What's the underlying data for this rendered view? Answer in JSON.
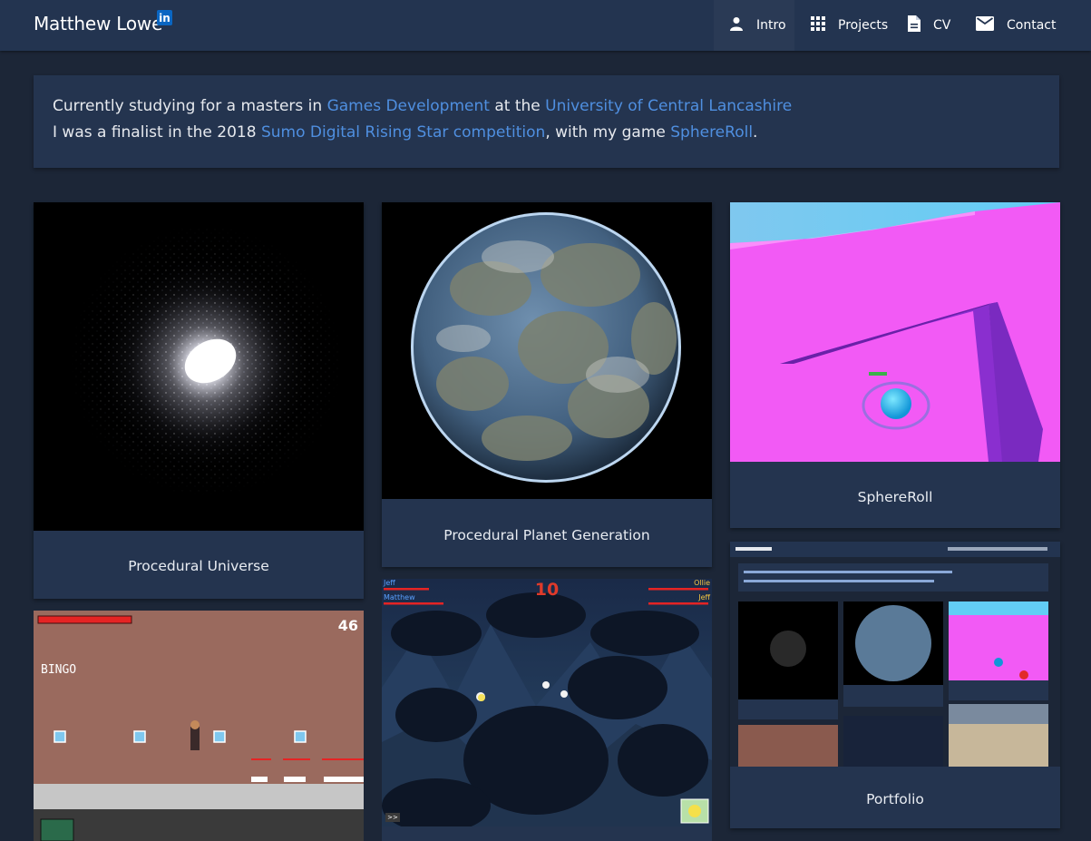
{
  "nav": {
    "brand": "Matthew Lowe",
    "linkedin_badge": "in",
    "items": [
      {
        "label": "Intro",
        "icon": "person-icon",
        "active": true
      },
      {
        "label": "Projects",
        "icon": "grid-icon",
        "active": false
      },
      {
        "label": "CV",
        "icon": "document-icon",
        "active": false
      },
      {
        "label": "Contact",
        "icon": "mail-icon",
        "active": false
      }
    ]
  },
  "intro": {
    "line1_prefix": "Currently studying for a masters in ",
    "line1_link1": "Games Development",
    "line1_mid": " at the ",
    "line1_link2": "University of Central Lancashire",
    "line2_prefix": "I was a finalist in the 2018 ",
    "line2_link1": "Sumo Digital Rising Star competition",
    "line2_mid": ", with my game ",
    "line2_link2": "SphereRoll",
    "line2_suffix": "."
  },
  "projects": [
    {
      "title": "Procedural Universe"
    },
    {
      "title": "Procedural Planet Generation"
    },
    {
      "title": "SphereRoll"
    },
    {
      "title": "Portfolio"
    }
  ],
  "bingo_game": {
    "score": "46",
    "label": "BINGO"
  },
  "worms_game": {
    "timer": "10",
    "player_top_left": "Jeff",
    "player_second_left": "Matthew",
    "player_top_right": "Ollie",
    "player_second_right": "Jeff",
    "skip_button": ">>"
  },
  "colors": {
    "background": "#1c2637",
    "navbar": "#233450",
    "panel": "#24344f",
    "link": "#4f8fe0"
  }
}
